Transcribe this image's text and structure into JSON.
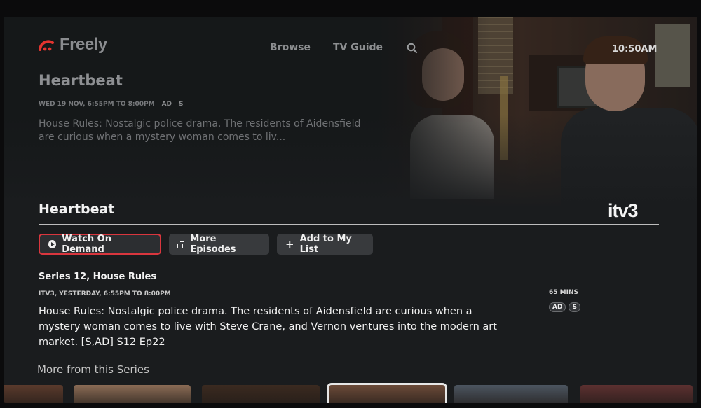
{
  "app": {
    "logo_text": "Freely",
    "brand_color": "#e3342f",
    "clock": "10:50AM"
  },
  "nav": {
    "browse": "Browse",
    "tv_guide": "TV Guide",
    "search_icon": "search-icon"
  },
  "hero": {
    "title": "Heartbeat",
    "meta": "WED 19 NOV, 6:55PM TO 8:00PM",
    "badges": [
      "AD",
      "S"
    ],
    "description": "House Rules: Nostalgic police drama. The residents of Aidensfield are curious when a mystery woman comes to liv..."
  },
  "detail": {
    "title": "Heartbeat",
    "channel": "itv3",
    "buttons": {
      "watch": "Watch On Demand",
      "more_episodes": "More Episodes",
      "add_list": "Add to My List"
    },
    "episode_title": "Series 12, House Rules",
    "episode_meta": "ITV3, YESTERDAY, 6:55PM TO 8:00PM",
    "description": "House Rules: Nostalgic police drama. The residents of Aidensfield are curious when a mystery woman comes to live with Steve Crane, and Vernon ventures into the modern art market. [S,AD] S12 Ep22",
    "duration": "65 MINS",
    "badges": [
      "AD",
      "S"
    ]
  },
  "more": {
    "heading": "More from this Series",
    "thumbnails": [
      {
        "color": "#5a3a2c",
        "focused": false
      },
      {
        "color": "#8a6b55",
        "focused": false
      },
      {
        "color": "#3b2a20",
        "focused": false
      },
      {
        "color": "#6b4a38",
        "focused": true
      },
      {
        "color": "#4c5560",
        "focused": false
      },
      {
        "color": "#5c3030",
        "focused": false
      }
    ]
  },
  "colors": {
    "focus_border": "#d9363e",
    "button_bg": "#383a3d",
    "background": "#1a1c1e"
  }
}
